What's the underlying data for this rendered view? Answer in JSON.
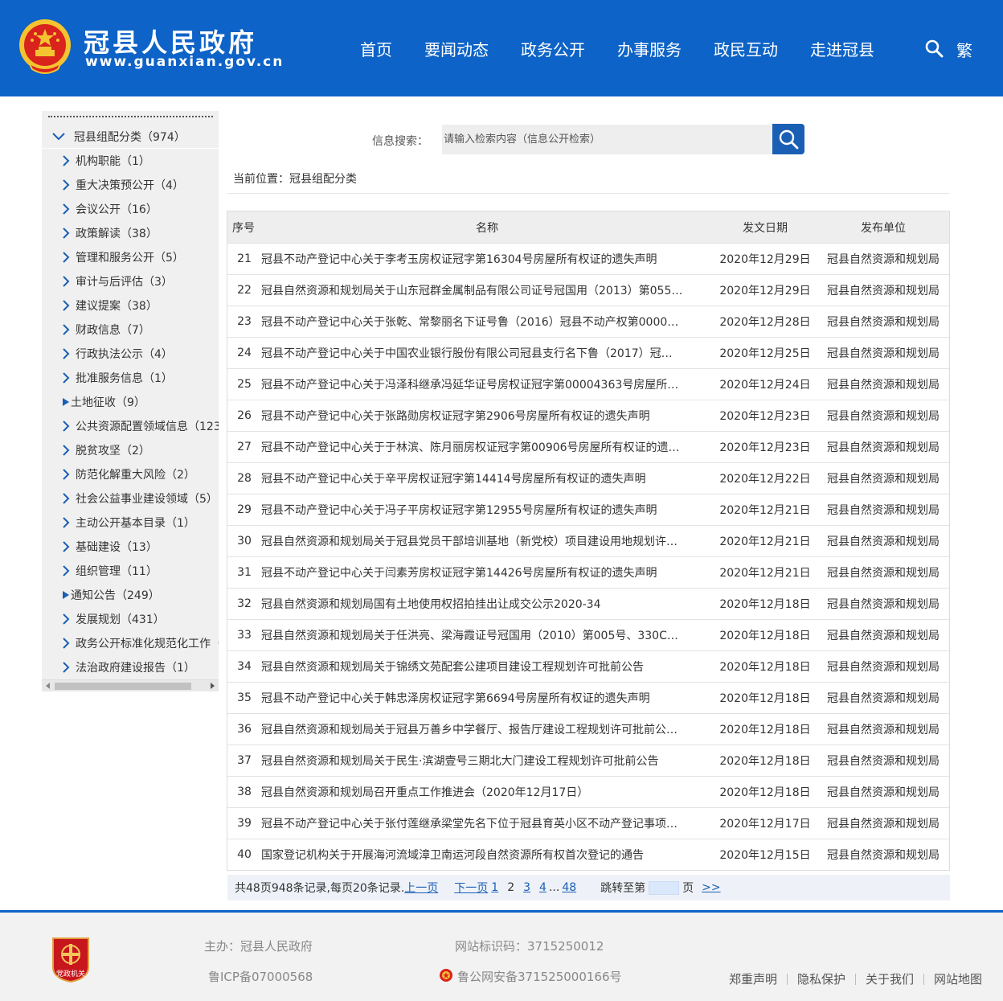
{
  "header": {
    "site_title": "冠县人民政府",
    "site_url": "www.guanxian.gov.cn",
    "nav": [
      "首页",
      "要闻动态",
      "政务公开",
      "办事服务",
      "政民互动",
      "走进冠县"
    ],
    "traditional_label": "繁",
    "brand_color": "#0d63c7"
  },
  "sidebar": {
    "root_label": "冠县组配分类（974）",
    "items": [
      {
        "label": "机构职能（1）",
        "marker": "arrow"
      },
      {
        "label": "重大决策预公开（4）",
        "marker": "arrow"
      },
      {
        "label": "会议公开（16）",
        "marker": "arrow"
      },
      {
        "label": "政策解读（38）",
        "marker": "arrow"
      },
      {
        "label": "管理和服务公开（5）",
        "marker": "arrow"
      },
      {
        "label": "审计与后评估（3）",
        "marker": "arrow"
      },
      {
        "label": "建议提案（38）",
        "marker": "arrow"
      },
      {
        "label": "财政信息（7）",
        "marker": "arrow"
      },
      {
        "label": "行政执法公示（4）",
        "marker": "arrow"
      },
      {
        "label": "批准服务信息（1）",
        "marker": "arrow"
      },
      {
        "label": "土地征收（9）",
        "marker": "triangle"
      },
      {
        "label": "公共资源配置领域信息（123",
        "marker": "arrow"
      },
      {
        "label": "脱贫攻坚（2）",
        "marker": "arrow"
      },
      {
        "label": "防范化解重大风险（2）",
        "marker": "arrow"
      },
      {
        "label": "社会公益事业建设领域（5）",
        "marker": "arrow"
      },
      {
        "label": "主动公开基本目录（1）",
        "marker": "arrow"
      },
      {
        "label": "基础建设（13）",
        "marker": "arrow"
      },
      {
        "label": "组织管理（11）",
        "marker": "arrow"
      },
      {
        "label": "通知公告（249）",
        "marker": "triangle"
      },
      {
        "label": "发展规划（431）",
        "marker": "arrow"
      },
      {
        "label": "政务公开标准化规范化工作（",
        "marker": "arrow"
      },
      {
        "label": "法治政府建设报告（1）",
        "marker": "arrow"
      }
    ]
  },
  "search": {
    "label": "信息搜索：",
    "placeholder": "请输入检索内容（信息公开检索）"
  },
  "breadcrumb": "当前位置：冠县组配分类",
  "table": {
    "headers": {
      "no": "序号",
      "name": "名称",
      "date": "发文日期",
      "unit": "发布单位"
    },
    "rows": [
      {
        "no": "21",
        "name": "冠县不动产登记中心关于李考玉房权证冠字第16304号房屋所有权证的遗失声明",
        "date": "2020年12月29日",
        "unit": "冠县自然资源和规划局"
      },
      {
        "no": "22",
        "name": "冠县自然资源和规划局关于山东冠群金属制品有限公司证号冠国用（2013）第055…",
        "date": "2020年12月29日",
        "unit": "冠县自然资源和规划局"
      },
      {
        "no": "23",
        "name": "冠县不动产登记中心关于张乾、常黎丽名下证号鲁（2016）冠县不动产权第0000…",
        "date": "2020年12月28日",
        "unit": "冠县自然资源和规划局"
      },
      {
        "no": "24",
        "name": "冠县不动产登记中心关于中国农业银行股份有限公司冠县支行名下鲁（2017）冠…",
        "date": "2020年12月25日",
        "unit": "冠县自然资源和规划局"
      },
      {
        "no": "25",
        "name": "冠县不动产登记中心关于冯泽科继承冯延华证号房权证冠字第00004363号房屋所…",
        "date": "2020年12月24日",
        "unit": "冠县自然资源和规划局"
      },
      {
        "no": "26",
        "name": "冠县不动产登记中心关于张路勋房权证冠字第2906号房屋所有权证的遗失声明",
        "date": "2020年12月23日",
        "unit": "冠县自然资源和规划局"
      },
      {
        "no": "27",
        "name": "冠县不动产登记中心关于于林滨、陈月丽房权证冠字第00906号房屋所有权证的遗…",
        "date": "2020年12月23日",
        "unit": "冠县自然资源和规划局"
      },
      {
        "no": "28",
        "name": "冠县不动产登记中心关于辛平房权证冠字第14414号房屋所有权证的遗失声明",
        "date": "2020年12月22日",
        "unit": "冠县自然资源和规划局"
      },
      {
        "no": "29",
        "name": "冠县不动产登记中心关于冯子平房权证冠字第12955号房屋所有权证的遗失声明",
        "date": "2020年12月21日",
        "unit": "冠县自然资源和规划局"
      },
      {
        "no": "30",
        "name": "冠县自然资源和规划局关于冠县党员干部培训基地（新党校）项目建设用地规划许…",
        "date": "2020年12月21日",
        "unit": "冠县自然资源和规划局"
      },
      {
        "no": "31",
        "name": "冠县不动产登记中心关于闫素芳房权证冠字第14426号房屋所有权证的遗失声明",
        "date": "2020年12月21日",
        "unit": "冠县自然资源和规划局"
      },
      {
        "no": "32",
        "name": "冠县自然资源和规划局国有土地使用权招拍挂出让成交公示2020-34",
        "date": "2020年12月18日",
        "unit": "冠县自然资源和规划局"
      },
      {
        "no": "33",
        "name": "冠县自然资源和规划局关于任洪亮、梁海霞证号冠国用（2010）第005号、330C…",
        "date": "2020年12月18日",
        "unit": "冠县自然资源和规划局"
      },
      {
        "no": "34",
        "name": "冠县自然资源和规划局关于锦绣文苑配套公建项目建设工程规划许可批前公告",
        "date": "2020年12月18日",
        "unit": "冠县自然资源和规划局"
      },
      {
        "no": "35",
        "name": "冠县不动产登记中心关于韩忠泽房权证冠字第6694号房屋所有权证的遗失声明",
        "date": "2020年12月18日",
        "unit": "冠县自然资源和规划局"
      },
      {
        "no": "36",
        "name": "冠县自然资源和规划局关于冠县万善乡中学餐厅、报告厅建设工程规划许可批前公…",
        "date": "2020年12月18日",
        "unit": "冠县自然资源和规划局"
      },
      {
        "no": "37",
        "name": "冠县自然资源和规划局关于民生·滨湖壹号三期北大门建设工程规划许可批前公告",
        "date": "2020年12月18日",
        "unit": "冠县自然资源和规划局"
      },
      {
        "no": "38",
        "name": "冠县自然资源和规划局召开重点工作推进会（2020年12月17日）",
        "date": "2020年12月18日",
        "unit": "冠县自然资源和规划局"
      },
      {
        "no": "39",
        "name": "冠县不动产登记中心关于张付莲继承梁堂先名下位于冠县育英小区不动产登记事项…",
        "date": "2020年12月17日",
        "unit": "冠县自然资源和规划局"
      },
      {
        "no": "40",
        "name": "国家登记机构关于开展海河流域漳卫南运河段自然资源所有权首次登记的通告",
        "date": "2020年12月15日",
        "unit": "冠县自然资源和规划局"
      }
    ]
  },
  "pager": {
    "summary": "共48页948条记录,每页20条记录.",
    "prev": "上一页",
    "next": "下一页",
    "pages": [
      "1",
      "2",
      "3",
      "4"
    ],
    "current": "2",
    "ellipsis": "...",
    "last": "48",
    "jump_label": "跳转至第",
    "page_unit": "页",
    "go": ">>"
  },
  "footer": {
    "sponsor": "主办：冠县人民政府",
    "site_id": "网站标识码：3715250012",
    "icp": "鲁ICP备07000568",
    "police": "鲁公网安备371525000166号",
    "links": [
      "郑重声明",
      "隐私保护",
      "关于我们",
      "网站地图"
    ],
    "badge_text": "党政机关"
  }
}
